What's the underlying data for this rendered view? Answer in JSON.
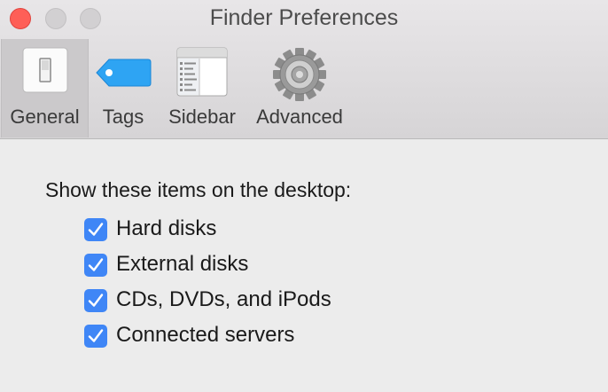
{
  "window": {
    "title": "Finder Preferences"
  },
  "tabs": [
    {
      "label": "General",
      "icon": "light-switch-icon",
      "selected": true
    },
    {
      "label": "Tags",
      "icon": "tag-icon",
      "selected": false
    },
    {
      "label": "Sidebar",
      "icon": "sidebar-icon",
      "selected": false
    },
    {
      "label": "Advanced",
      "icon": "gear-icon",
      "selected": false
    }
  ],
  "general": {
    "heading": "Show these items on the desktop:",
    "options": [
      {
        "label": "Hard disks",
        "checked": true
      },
      {
        "label": "External disks",
        "checked": true
      },
      {
        "label": "CDs, DVDs, and iPods",
        "checked": true
      },
      {
        "label": "Connected servers",
        "checked": true
      }
    ]
  },
  "colors": {
    "close": "#fe5f57",
    "checkbox": "#3f86f6",
    "tag": "#2ea4f3"
  }
}
